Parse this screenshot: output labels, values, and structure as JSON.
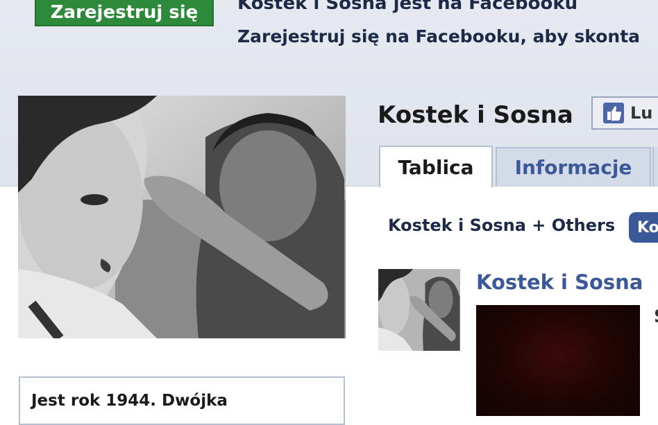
{
  "banner": {
    "signup_button": "Zarejestruj się",
    "title": "Kostek i Sosna jest na Facebooku",
    "subtitle": "Zarejestruj się na Facebooku, aby skonta"
  },
  "profile": {
    "name": "Kostek i Sosna",
    "like_button": "Lu"
  },
  "tabs": [
    {
      "label": "Tablica",
      "active": true
    },
    {
      "label": "Informacje",
      "active": false
    }
  ],
  "wall": {
    "filter_label": "Kostek i Sosna + Others",
    "filter_pill": "Ko",
    "post": {
      "author": "Kostek i Sosna",
      "side_char": "S"
    }
  },
  "about": {
    "text": "Jest rok 1944. Dwójka"
  },
  "colors": {
    "signup_green": "#2e8a3b",
    "facebook_blue": "#3b5998",
    "top_band": "#e3e7ef"
  }
}
